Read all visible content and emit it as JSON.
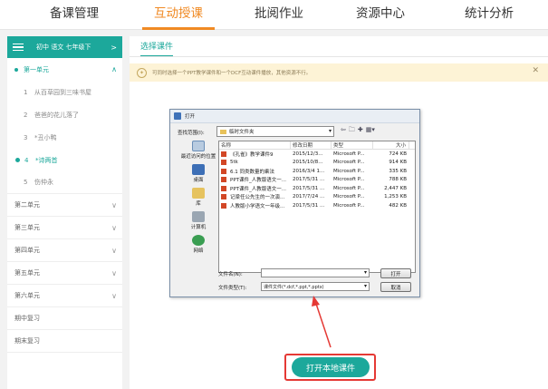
{
  "nav": {
    "tabs": [
      "备课管理",
      "互动授课",
      "批阅作业",
      "资源中心",
      "统计分析"
    ],
    "active_index": 1
  },
  "sidebar": {
    "header": "初中 语文 七年级下",
    "header_chevron": ">",
    "open_unit": "第一单元",
    "lessons": [
      {
        "num": "1",
        "title": "从百草园到三味书屋"
      },
      {
        "num": "2",
        "title": "爸爸的花儿落了"
      },
      {
        "num": "3",
        "title": "*丑小鸭"
      },
      {
        "num": "4",
        "title": "*诗两首"
      },
      {
        "num": "5",
        "title": "伤仲永"
      }
    ],
    "active_lesson_index": 3,
    "units": [
      "第二单元",
      "第三单元",
      "第四单元",
      "第五单元",
      "第六单元"
    ],
    "reviews": [
      "期中复习",
      "期末复习"
    ]
  },
  "main": {
    "tab": "选择课件",
    "notice": "可同时选择一个PPT教学课件和一个DCF互动课件播放，其他资源不行。",
    "notice_close": "✕"
  },
  "dialog": {
    "title": "打开",
    "look_in_label": "查找范围(I):",
    "look_in_value": "临时文件夹",
    "places": [
      "最近访问的位置",
      "桌面",
      "库",
      "计算机",
      "网络"
    ],
    "columns": [
      "名称",
      "修改日期",
      "类型",
      "大小"
    ],
    "files": [
      {
        "name": "《孔雀》教学课件9",
        "date": "2015/12/3...",
        "type": "Microsoft P...",
        "size": "724 KB",
        "kind": "ppt"
      },
      {
        "name": "5tk",
        "date": "2015/10/8...",
        "type": "Microsoft P...",
        "size": "914 KB",
        "kind": "ppt"
      },
      {
        "name": "6.1 同类数量的乘法",
        "date": "2016/3/4 1...",
        "type": "Microsoft P...",
        "size": "335 KB",
        "kind": "ppt"
      },
      {
        "name": "PPT课件_人教版语文一...",
        "date": "2017/5/31 ...",
        "type": "Microsoft P...",
        "size": "788 KB",
        "kind": "ppt"
      },
      {
        "name": "PPT课件_人教版语文一...",
        "date": "2017/5/31 ...",
        "type": "Microsoft P...",
        "size": "2,447 KB",
        "kind": "ppt"
      },
      {
        "name": "记梁任公先生的一次演...",
        "date": "2017/7/24 ...",
        "type": "Microsoft P...",
        "size": "1,253 KB",
        "kind": "ppt"
      },
      {
        "name": "人教版小学语文一年级...",
        "date": "2017/5/31 ...",
        "type": "Microsoft P...",
        "size": "482 KB",
        "kind": "ppt"
      }
    ],
    "filename_label": "文件名(N):",
    "filename_value": "",
    "filetype_label": "文件类型(T):",
    "filetype_value": "课件文件(*.dcf,*.ppt,*.pptx)",
    "open_button": "打开",
    "cancel_button": "取消"
  },
  "upload_button": "打开本地课件",
  "colors": {
    "accent_teal": "#1ca89b",
    "nav_active": "#f08a24",
    "highlight_red": "#e53935"
  }
}
